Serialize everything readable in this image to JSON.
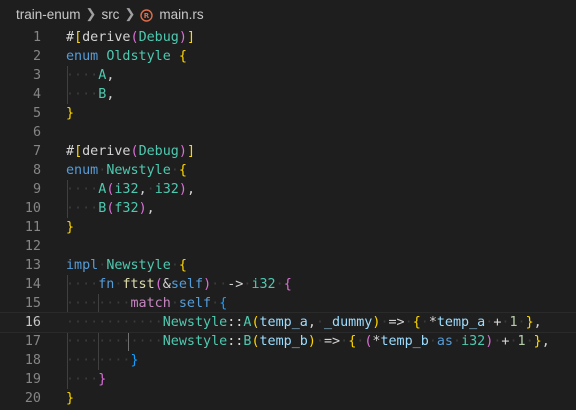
{
  "breadcrumb": {
    "items": [
      "train-enum",
      "src",
      "main.rs"
    ],
    "icons": [
      "chevron-right-icon",
      "rust-icon"
    ]
  },
  "editor": {
    "active_line": 16,
    "lines": [
      {
        "n": "1"
      },
      {
        "n": "2"
      },
      {
        "n": "3"
      },
      {
        "n": "4"
      },
      {
        "n": "5"
      },
      {
        "n": "6"
      },
      {
        "n": "7"
      },
      {
        "n": "8"
      },
      {
        "n": "9"
      },
      {
        "n": "10"
      },
      {
        "n": "11"
      },
      {
        "n": "12"
      },
      {
        "n": "13"
      },
      {
        "n": "14"
      },
      {
        "n": "15"
      },
      {
        "n": "16"
      },
      {
        "n": "17"
      },
      {
        "n": "18"
      },
      {
        "n": "19"
      },
      {
        "n": "20"
      }
    ],
    "code": {
      "l1": "#[derive(Debug)]",
      "l2": "enum Oldstyle {",
      "l3": "A,",
      "l4": "B,",
      "l5": "}",
      "l7": "#[derive(Debug)]",
      "l8": "enum Newstyle {",
      "l9": "A(i32, i32),",
      "l10": "B(f32),",
      "l11": "}",
      "l13": "impl Newstyle {",
      "l14": "fn ftst(&self) -> i32 {",
      "l15": "match self {",
      "l16": "Newstyle::A(temp_a, _dummy) => { *temp_a + 1 },",
      "l17": "Newstyle::B(temp_b) => { (*temp_b as i32) + 1 },",
      "l18": "}",
      "l19": "}",
      "l20": "}"
    }
  },
  "colors": {
    "background": "#1e1e1e",
    "keyword": "#569cd6",
    "type": "#4ec9b0",
    "function": "#dcdcaa",
    "variable": "#9cdcfe",
    "number": "#b5cea8",
    "bracket_level1": "#ffd700",
    "bracket_level2": "#da70d6",
    "bracket_level3": "#179fff",
    "line_number": "#858585"
  }
}
